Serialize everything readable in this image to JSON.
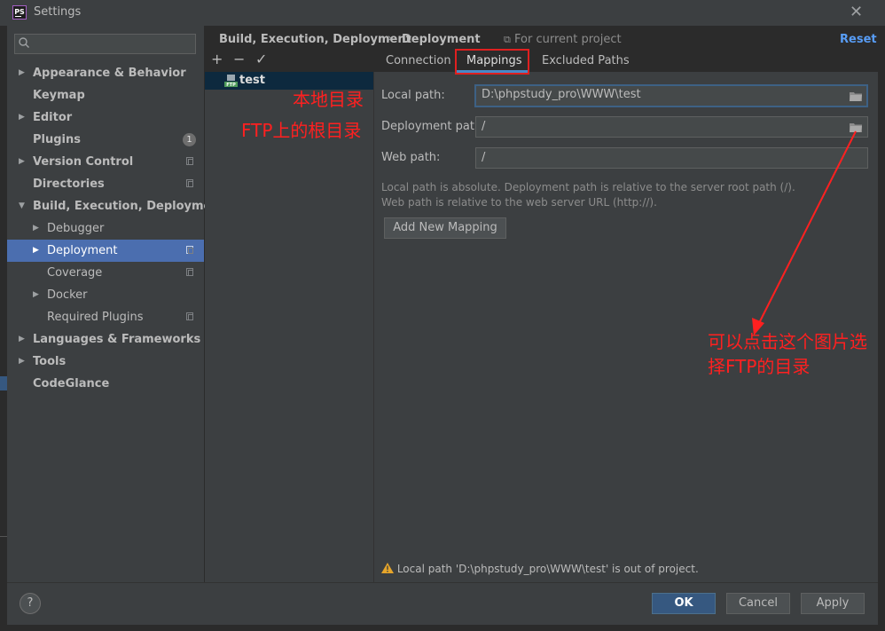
{
  "window": {
    "title": "Settings",
    "app_icon": "PS",
    "close_glyph": "✕"
  },
  "sidebar": {
    "search_placeholder": "Q-",
    "items": [
      {
        "label": "Appearance & Behavior",
        "arrow": "▶"
      },
      {
        "label": "Keymap"
      },
      {
        "label": "Editor",
        "arrow": "▶"
      },
      {
        "label": "Plugins",
        "badge": "1"
      },
      {
        "label": "Version Control",
        "arrow": "▶"
      },
      {
        "label": "Directories"
      },
      {
        "label": "Build, Execution, Deployment",
        "arrow": "▼"
      },
      {
        "label": "Debugger",
        "arrow": "▶"
      },
      {
        "label": "Deployment",
        "arrow": "▶"
      },
      {
        "label": "Coverage"
      },
      {
        "label": "Docker",
        "arrow": "▶"
      },
      {
        "label": "Required Plugins"
      },
      {
        "label": "Languages & Frameworks",
        "arrow": "▶"
      },
      {
        "label": "Tools",
        "arrow": "▶"
      },
      {
        "label": "CodeGlance"
      }
    ]
  },
  "header": {
    "breadcrumb_parent": "Build, Execution, Deployment",
    "breadcrumb_sep": "›",
    "breadcrumb_current": "Deployment",
    "scope_label": "For current project",
    "reset_label": "Reset"
  },
  "server_list": {
    "toolbar": {
      "add": "+",
      "remove": "−",
      "check": "✓"
    },
    "servers": [
      {
        "name": "test",
        "type": "FTP"
      }
    ]
  },
  "tabs": [
    {
      "label": "Connection"
    },
    {
      "label": "Mappings",
      "active": true
    },
    {
      "label": "Excluded Paths"
    }
  ],
  "mappings": {
    "local_path_label": "Local path:",
    "local_path_value": "D:\\phpstudy_pro\\WWW\\test",
    "deployment_path_label": "Deployment path:",
    "deployment_path_value": "/",
    "web_path_label": "Web path:",
    "web_path_value": "/",
    "help_line1": "Local path is absolute. Deployment path is relative to the server root path (/).",
    "help_line2": "Web path is relative to the web server URL (http://).",
    "add_mapping_label": "Add New Mapping"
  },
  "warning": {
    "icon": "warning-icon",
    "text": "Local path 'D:\\phpstudy_pro\\WWW\\test' is out of project."
  },
  "footer": {
    "help": "?",
    "ok": "OK",
    "cancel": "Cancel",
    "apply": "Apply"
  },
  "annotations": {
    "local_dir": "本地目录",
    "ftp_root": "FTP上的根目录",
    "hint_line1": "可以点击这个图片选",
    "hint_line2": "择FTP的目录",
    "color": "#ff2020"
  },
  "colors": {
    "background": "#2b2b2b",
    "panel": "#3c3f41",
    "selection": "#4b6eaf",
    "link": "#589df6",
    "primary_button": "#365880",
    "tab_underline": "#4a88c7"
  }
}
